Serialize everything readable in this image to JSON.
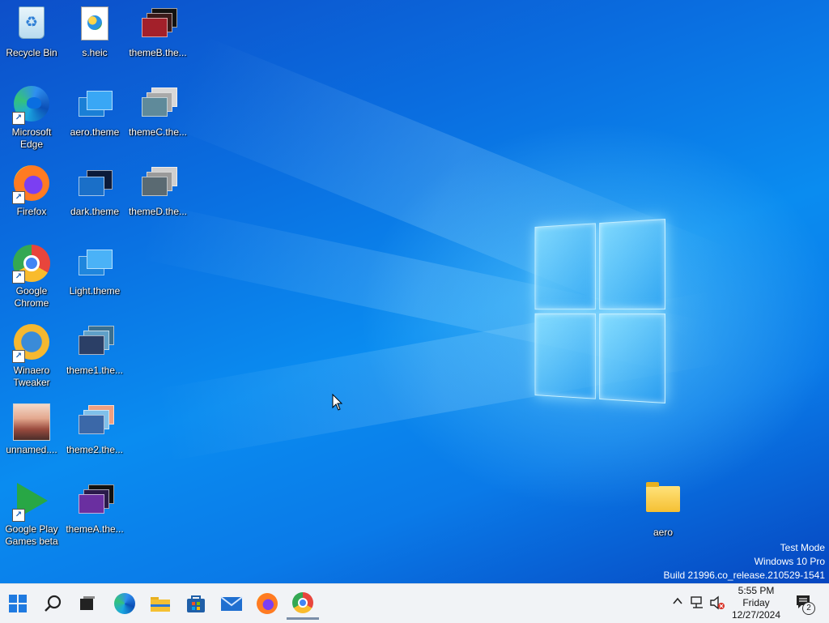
{
  "desktop_icons": {
    "recycle_bin": "Recycle Bin",
    "s_heic": "s.heic",
    "themeB": "themeB.the...",
    "edge": "Microsoft Edge",
    "aero_theme": "aero.theme",
    "themeC": "themeC.the...",
    "firefox": "Firefox",
    "dark_theme": "dark.theme",
    "themeD": "themeD.the...",
    "chrome": "Google Chrome",
    "light_theme": "Light.theme",
    "winaero": "Winaero Tweaker",
    "theme1": "theme1.the...",
    "unnamed": "unnamed....",
    "theme2": "theme2.the...",
    "play_games": "Google Play Games beta",
    "themeA": "themeA.the...",
    "aero_folder": "aero"
  },
  "watermark": {
    "line1": "Test Mode",
    "line2": "Windows 10 Pro",
    "line3": "Build 21996.co_release.210529-1541"
  },
  "taskbar": {
    "items": [
      "start-icon",
      "search-icon",
      "task-view-icon",
      "edge-icon",
      "file-explorer-icon",
      "store-icon",
      "mail-icon",
      "firefox-icon",
      "chrome-icon"
    ],
    "tray": {
      "time": "5:55 PM",
      "day": "Friday",
      "date": "12/27/2024",
      "notification_count": "2"
    }
  },
  "colors": {
    "accent": "#1f7ae0",
    "taskbar_bg": "#f1f3f6"
  }
}
